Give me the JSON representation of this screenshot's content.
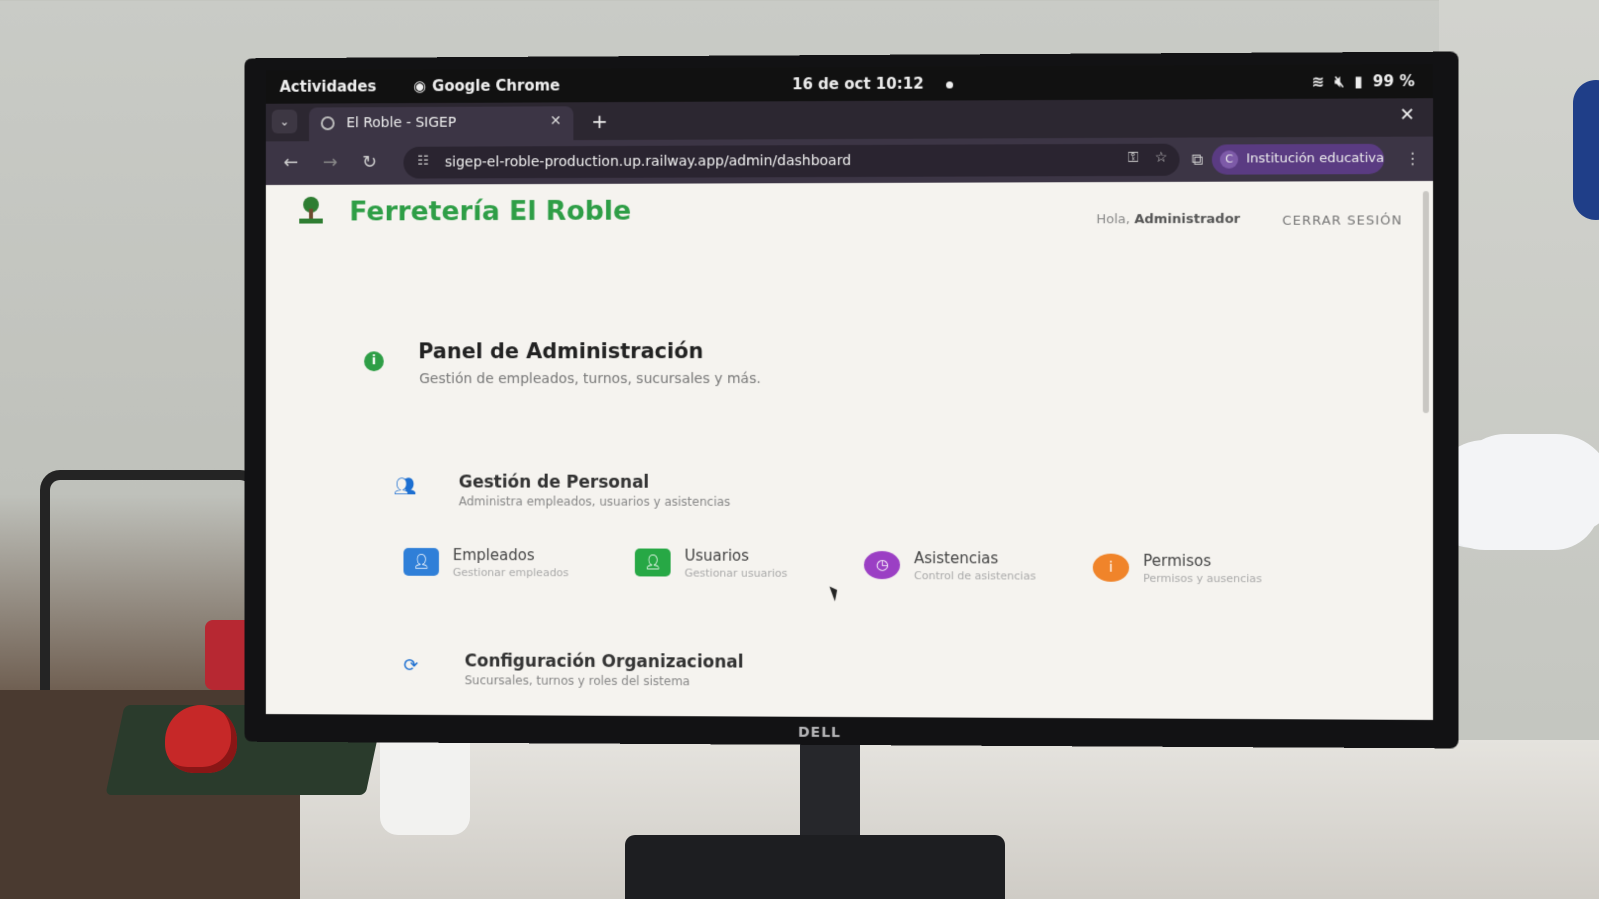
{
  "desktop": {
    "activities": "Actividades",
    "app_name": "Google Chrome",
    "clock": "16 de oct  10:12",
    "battery": "99 %"
  },
  "browser": {
    "tab_title": "El Roble - SIGEP",
    "url": "sigep-el-roble-production.up.railway.app/admin/dashboard",
    "profile_initial": "C",
    "profile_label": "Institución educativa"
  },
  "header": {
    "brand": "Ferretería El Roble",
    "greeting_prefix": "Hola,",
    "greeting_user": "Administrador",
    "logout": "CERRAR SESIÓN"
  },
  "panel": {
    "title": "Panel de Administración",
    "subtitle": "Gestión de empleados, turnos, sucursales y más."
  },
  "sections": [
    {
      "title": "Gestión de Personal",
      "subtitle": "Administra empleados, usuarios y asistencias",
      "cards": [
        {
          "title": "Empleados",
          "subtitle": "Gestionar empleados",
          "color": "#2f7fd8",
          "icon": "person-icon"
        },
        {
          "title": "Usuarios",
          "subtitle": "Gestionar usuarios",
          "color": "#27a845",
          "icon": "user-add-icon"
        },
        {
          "title": "Asistencias",
          "subtitle": "Control de asistencias",
          "color": "#9b3fc4",
          "icon": "clock-icon"
        },
        {
          "title": "Permisos",
          "subtitle": "Permisos y ausencias",
          "color": "#f0842a",
          "icon": "info-icon"
        }
      ]
    },
    {
      "title": "Configuración Organizacional",
      "subtitle": "Sucursales, turnos y roles del sistema"
    }
  ],
  "monitor_brand": "DELL"
}
